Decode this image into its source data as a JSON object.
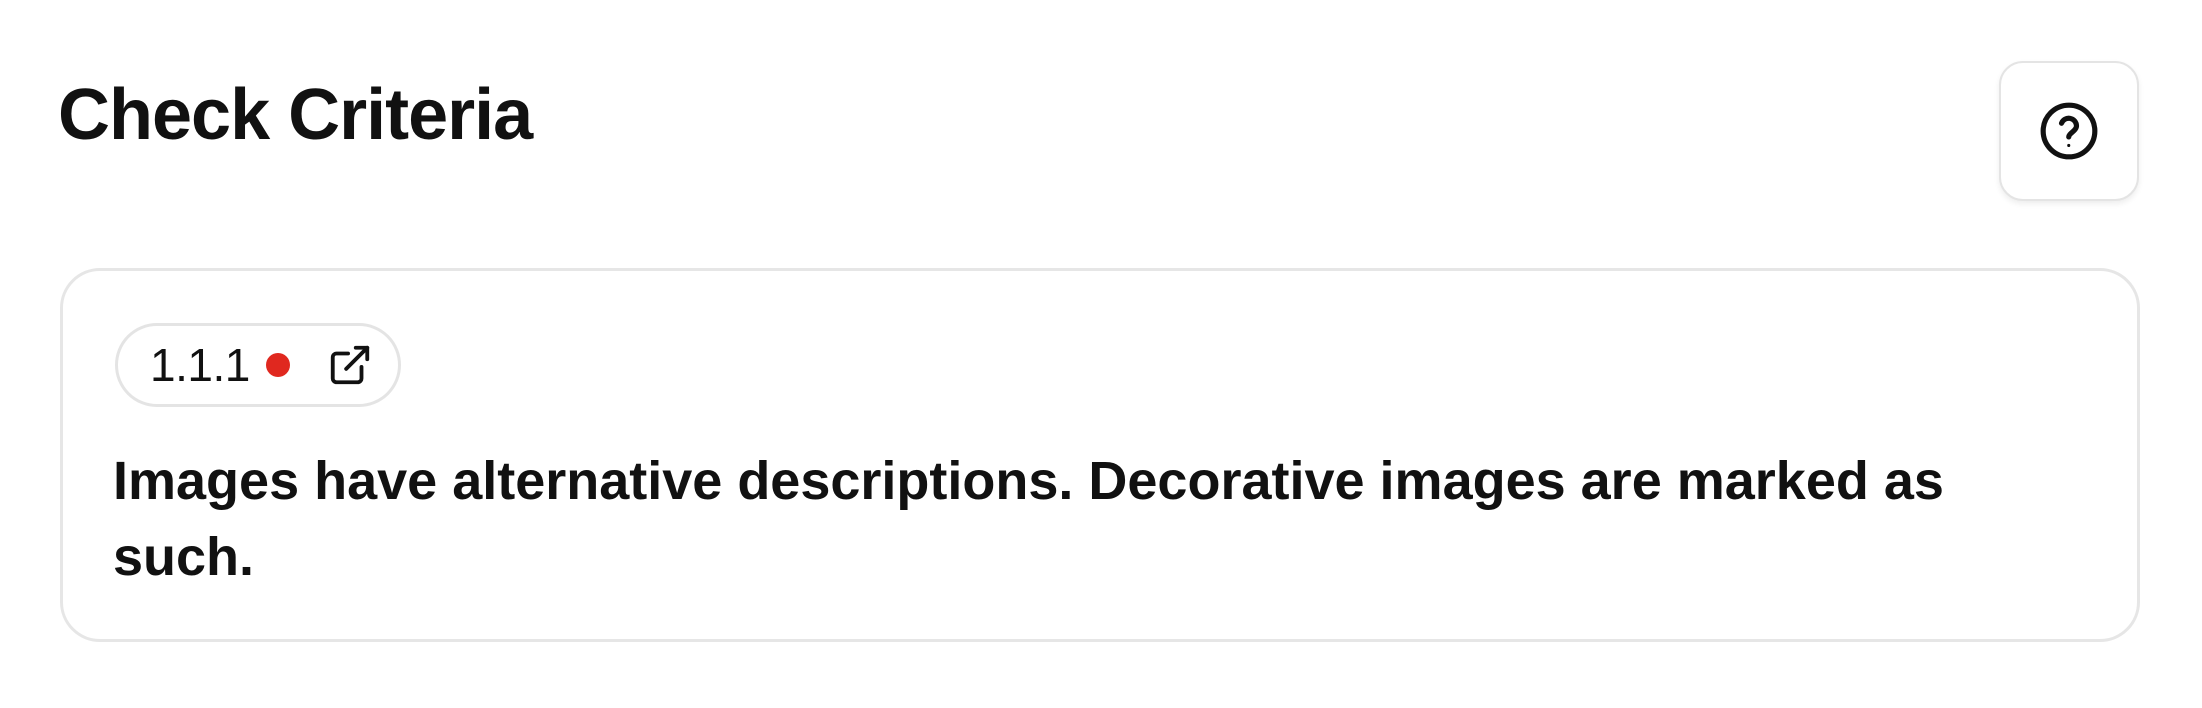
{
  "header": {
    "title": "Check Criteria",
    "help_icon": "question-circle-icon"
  },
  "criterion": {
    "id": "1.1.1",
    "status_color": "#e0281f",
    "link_icon": "external-link-icon",
    "description": "Images have alternative descriptions. Decorative images are marked as such."
  }
}
